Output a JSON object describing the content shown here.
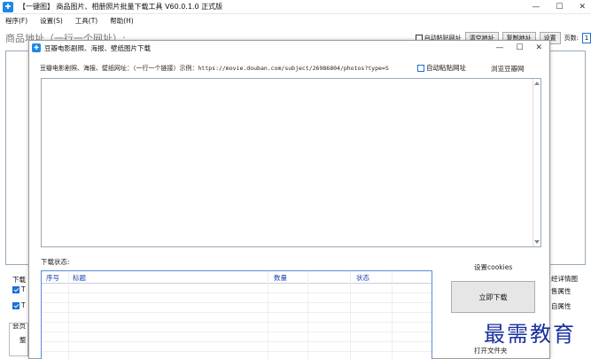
{
  "main_window": {
    "title": "【一键图】 商品图片、相册照片批量下载工具 V60.0.1.0 正式版",
    "controls": [
      "—",
      "☐",
      "✕"
    ],
    "menu": [
      "程序(F)",
      "设置(S)",
      "工具(T)",
      "帮助(H)"
    ],
    "url_label": "商品地址（一行一个网址）:",
    "toolbar": {
      "auto_paste_label": "自动粘贴网址",
      "clear_button": "清空地址",
      "copy_button": "复制地址",
      "settings_button": "设置",
      "page_label": "页数:",
      "page_value": "1"
    },
    "left_bits": [
      "下载",
      "T",
      "T",
      "会员",
      "整"
    ],
    "right_bits": [
      "经详情图",
      "售属性",
      "自属性"
    ]
  },
  "dialog": {
    "title": "豆瓣电影剧照、海报、壁纸图片下载",
    "controls": [
      "—",
      "☐",
      "✕"
    ],
    "url_label": "豆瓣电影剧照、海报、壁纸网址：（一行一个链接）示例：",
    "url_example": "https://movie.douban.com/subject/26986804/photos?type=S",
    "auto_paste_label": "自动粘贴网址",
    "browse_link": "浏览豆瓣网",
    "status_label": "下载状态:",
    "cookies_label": "设置cookies",
    "table_headers": [
      "序号",
      "标题",
      "数量",
      "状态"
    ],
    "download_button": "立即下载",
    "open_folder": "打开文件夹"
  },
  "watermark": "最需教育",
  "colors": {
    "accent": "#1a6fd8",
    "table_border": "#5b8bd6",
    "header_text": "#1a3fb0",
    "watermark": "#1a2fa0"
  }
}
